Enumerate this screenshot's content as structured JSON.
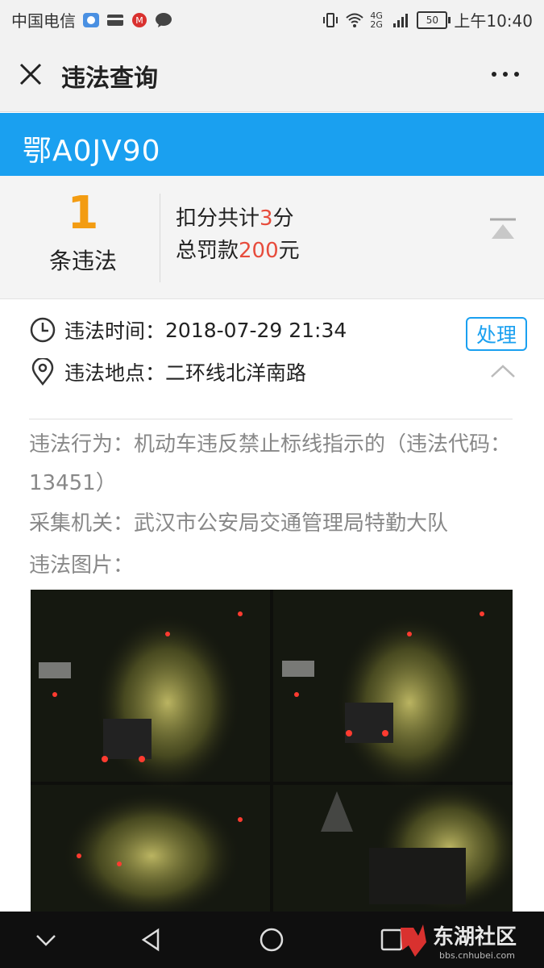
{
  "status_bar": {
    "carrier": "中国电信",
    "network": "4G 2G",
    "battery": "50",
    "time": "上午10:40"
  },
  "header": {
    "title": "违法查询",
    "close_icon": "close-icon",
    "more_icon": "more-icon"
  },
  "vehicle": {
    "plate": "鄂A0JV90"
  },
  "summary": {
    "count": "1",
    "count_label": "条违法",
    "points_prefix": "扣分共计",
    "points": "3",
    "points_suffix": "分",
    "fine_prefix": "总罚款",
    "fine": "200",
    "fine_suffix": "元"
  },
  "violation": {
    "time_label": "违法时间：",
    "time": "2018-07-29 21:34",
    "place_label": "违法地点：",
    "place": "二环线北洋南路",
    "handle_button": "处理",
    "behavior_label": "违法行为：",
    "behavior": "机动车违反禁止标线指示的（违法代码：13451）",
    "authority_label": "采集机关：",
    "authority": "武汉市公安局交通管理局特勤大队",
    "pictures_label": "违法图片："
  },
  "watermark": {
    "text": "东湖社区",
    "url": "bbs.cnhubei.com"
  },
  "colors": {
    "accent_blue": "#1aa0f0",
    "count_orange": "#f39c12",
    "highlight_red": "#e74c3c"
  }
}
